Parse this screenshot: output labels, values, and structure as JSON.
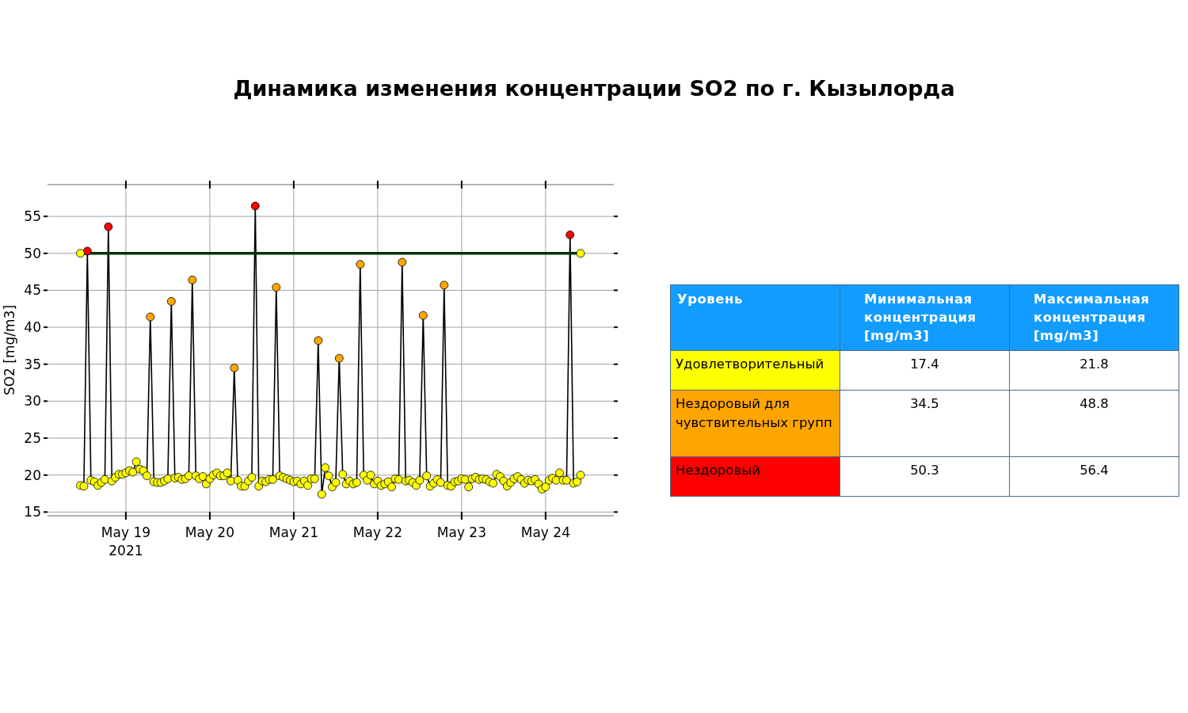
{
  "title": "Динамика изменения концентрации SO2 по г. Кызылорда",
  "chart": {
    "chart_data": {
      "type": "line",
      "ylabel": "SO2 [mg/m3]",
      "x": [
        "2021-05-18 11:00",
        "2021-05-18 12:00",
        "2021-05-18 13:00",
        "2021-05-18 14:00",
        "2021-05-18 15:00",
        "2021-05-18 16:00",
        "2021-05-18 17:00",
        "2021-05-18 18:00",
        "2021-05-18 19:00",
        "2021-05-18 20:00",
        "2021-05-18 21:00",
        "2021-05-18 22:00",
        "2021-05-18 23:00",
        "2021-05-19 00:00",
        "2021-05-19 01:00",
        "2021-05-19 02:00",
        "2021-05-19 03:00",
        "2021-05-19 04:00",
        "2021-05-19 05:00",
        "2021-05-19 06:00",
        "2021-05-19 07:00",
        "2021-05-19 08:00",
        "2021-05-19 09:00",
        "2021-05-19 10:00",
        "2021-05-19 11:00",
        "2021-05-19 12:00",
        "2021-05-19 13:00",
        "2021-05-19 14:00",
        "2021-05-19 15:00",
        "2021-05-19 16:00",
        "2021-05-19 17:00",
        "2021-05-19 18:00",
        "2021-05-19 19:00",
        "2021-05-19 20:00",
        "2021-05-19 21:00",
        "2021-05-19 22:00",
        "2021-05-19 23:00",
        "2021-05-20 00:00",
        "2021-05-20 01:00",
        "2021-05-20 02:00",
        "2021-05-20 03:00",
        "2021-05-20 04:00",
        "2021-05-20 05:00",
        "2021-05-20 06:00",
        "2021-05-20 07:00",
        "2021-05-20 08:00",
        "2021-05-20 09:00",
        "2021-05-20 10:00",
        "2021-05-20 11:00",
        "2021-05-20 12:00",
        "2021-05-20 13:00",
        "2021-05-20 14:00",
        "2021-05-20 15:00",
        "2021-05-20 16:00",
        "2021-05-20 17:00",
        "2021-05-20 18:00",
        "2021-05-20 19:00",
        "2021-05-20 20:00",
        "2021-05-20 21:00",
        "2021-05-20 22:00",
        "2021-05-20 23:00",
        "2021-05-21 00:00",
        "2021-05-21 01:00",
        "2021-05-21 02:00",
        "2021-05-21 03:00",
        "2021-05-21 04:00",
        "2021-05-21 05:00",
        "2021-05-21 06:00",
        "2021-05-21 07:00",
        "2021-05-21 08:00",
        "2021-05-21 09:00",
        "2021-05-21 10:00",
        "2021-05-21 11:00",
        "2021-05-21 12:00",
        "2021-05-21 13:00",
        "2021-05-21 14:00",
        "2021-05-21 15:00",
        "2021-05-21 16:00",
        "2021-05-21 17:00",
        "2021-05-21 18:00",
        "2021-05-21 19:00",
        "2021-05-21 20:00",
        "2021-05-21 21:00",
        "2021-05-21 22:00",
        "2021-05-21 23:00",
        "2021-05-22 00:00",
        "2021-05-22 01:00",
        "2021-05-22 02:00",
        "2021-05-22 03:00",
        "2021-05-22 04:00",
        "2021-05-22 05:00",
        "2021-05-22 06:00",
        "2021-05-22 07:00",
        "2021-05-22 08:00",
        "2021-05-22 09:00",
        "2021-05-22 10:00",
        "2021-05-22 11:00",
        "2021-05-22 12:00",
        "2021-05-22 13:00",
        "2021-05-22 14:00",
        "2021-05-22 15:00",
        "2021-05-22 16:00",
        "2021-05-22 17:00",
        "2021-05-22 18:00",
        "2021-05-22 19:00",
        "2021-05-22 20:00",
        "2021-05-22 21:00",
        "2021-05-22 22:00",
        "2021-05-22 23:00",
        "2021-05-23 00:00",
        "2021-05-23 01:00",
        "2021-05-23 02:00",
        "2021-05-23 03:00",
        "2021-05-23 04:00",
        "2021-05-23 05:00",
        "2021-05-23 06:00",
        "2021-05-23 07:00",
        "2021-05-23 08:00",
        "2021-05-23 09:00",
        "2021-05-23 10:00",
        "2021-05-23 11:00",
        "2021-05-23 12:00",
        "2021-05-23 13:00",
        "2021-05-23 14:00",
        "2021-05-23 15:00",
        "2021-05-23 16:00",
        "2021-05-23 17:00",
        "2021-05-23 18:00",
        "2021-05-23 19:00",
        "2021-05-23 20:00",
        "2021-05-23 21:00",
        "2021-05-23 22:00",
        "2021-05-23 23:00",
        "2021-05-24 00:00",
        "2021-05-24 01:00",
        "2021-05-24 02:00",
        "2021-05-24 03:00",
        "2021-05-24 04:00",
        "2021-05-24 05:00",
        "2021-05-24 06:00",
        "2021-05-24 07:00",
        "2021-05-24 08:00",
        "2021-05-24 09:00",
        "2021-05-24 10:00"
      ],
      "series": [
        {
          "color": "#000000",
          "marker": true,
          "values": [
            18.6,
            18.5,
            50.3,
            19.3,
            19.1,
            18.6,
            19,
            19.4,
            53.6,
            19.2,
            19.7,
            20.1,
            20.1,
            20.3,
            20.6,
            20.4,
            21.8,
            20.8,
            20.6,
            19.9,
            41.4,
            19.1,
            19,
            19,
            19.2,
            19.5,
            43.5,
            19.6,
            19.7,
            19.4,
            19.5,
            19.9,
            46.4,
            19.9,
            19.5,
            19.8,
            18.8,
            19.5,
            20,
            20.3,
            19.9,
            19.9,
            20.3,
            19.2,
            34.5,
            19.3,
            18.5,
            18.5,
            19.2,
            19.7,
            56.4,
            18.5,
            19.2,
            19.1,
            19.4,
            19.4,
            45.4,
            19.9,
            19.7,
            19.5,
            19.3,
            19.1,
            19.2,
            18.8,
            19.2,
            18.6,
            19.5,
            19.5,
            38.2,
            17.4,
            21,
            19.9,
            18.4,
            19,
            35.8,
            20.1,
            18.8,
            19.2,
            18.8,
            19,
            48.5,
            20,
            19.3,
            20,
            18.8,
            19.2,
            18.6,
            18.8,
            19.1,
            18.4,
            19.5,
            19.4,
            48.8,
            19.2,
            19.3,
            19,
            18.6,
            19.3,
            41.6,
            19.9,
            18.5,
            18.9,
            19.4,
            19,
            45.7,
            18.6,
            18.5,
            19.1,
            19.2,
            19.5,
            19.4,
            18.4,
            19.5,
            19.7,
            19.4,
            19.5,
            19.4,
            19.1,
            18.9,
            20.1,
            19.8,
            19.2,
            18.5,
            19,
            19.5,
            19.8,
            19.4,
            18.9,
            19.3,
            19.2,
            19.4,
            18.8,
            18.1,
            18.4,
            19.3,
            19.6,
            19.3,
            20.3,
            19.3,
            19.3,
            52.5,
            18.9,
            19.1,
            20
          ]
        },
        {
          "color": "#003300",
          "marker": {
            "color": "#ffff00"
          },
          "x": [
            "2021-05-18 11:00",
            "2021-05-24 10:00"
          ],
          "values": [
            50,
            50
          ]
        }
      ],
      "grid": true,
      "xlim": [
        "2021-05-18 01:36",
        "2021-05-24 19:30"
      ],
      "ylim": [
        14.5,
        59.3
      ],
      "xticks": [
        {
          "value": "2021-05-19 00:00",
          "label": "May 19\n2021"
        },
        {
          "value": "2021-05-20 00:00",
          "label": "May 20"
        },
        {
          "value": "2021-05-21 00:00",
          "label": "May 21"
        },
        {
          "value": "2021-05-22 00:00",
          "label": "May 22"
        },
        {
          "value": "2021-05-23 00:00",
          "label": "May 23"
        },
        {
          "value": "2021-05-24 00:00",
          "label": "May 24"
        }
      ],
      "yticks": [
        15,
        20,
        25,
        30,
        35,
        40,
        45,
        50,
        55
      ]
    }
  },
  "table": {
    "columns": [
      "Уровень",
      "Минимальная концентрация [mg/m3]",
      "Максимальная концентрация [mg/m3]"
    ],
    "rows": [
      {
        "level": "Удовлетворительный",
        "color": "#ffff00",
        "min": "17.4",
        "max": "21.8"
      },
      {
        "level": "Нездоровый для чувствительных групп",
        "color": "#ffa500",
        "min": "34.5",
        "max": "48.8"
      },
      {
        "level": "Нездоровый",
        "color": "#ff0000",
        "min": "50.3",
        "max": "56.4"
      }
    ]
  }
}
